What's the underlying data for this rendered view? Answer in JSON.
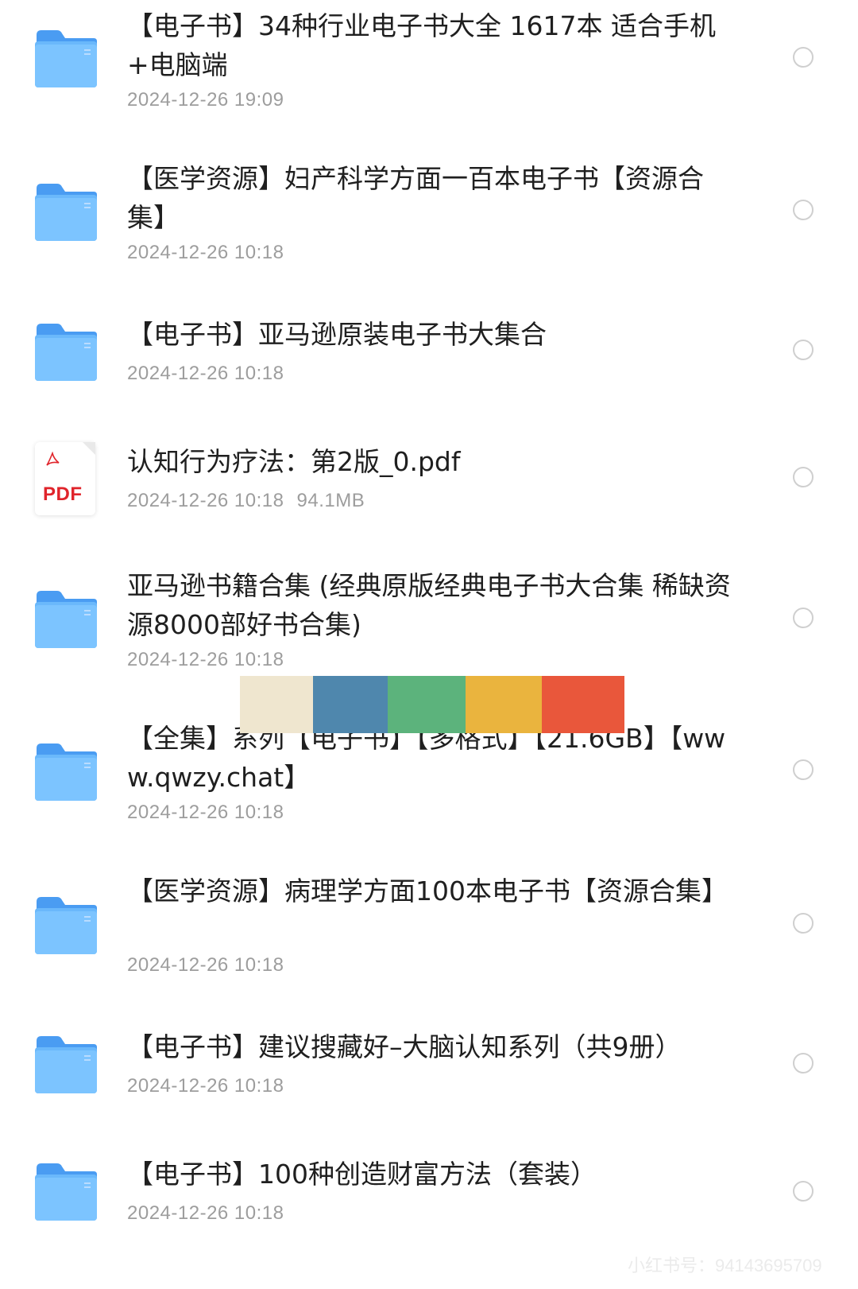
{
  "files": [
    {
      "type": "folder",
      "title": "【电子书】34种行业电子书大全 1617本 适合手机+电脑端",
      "date": "2024-12-26 19:09",
      "size": ""
    },
    {
      "type": "folder",
      "title": "【医学资源】妇产科学方面一百本电子书【资源合集】",
      "date": "2024-12-26 10:18",
      "size": ""
    },
    {
      "type": "folder",
      "title": "【电子书】亚马逊原装电子书大集合",
      "date": "2024-12-26 10:18",
      "size": ""
    },
    {
      "type": "pdf",
      "title": "认知行为疗法：第2版_0.pdf",
      "date": "2024-12-26 10:18",
      "size": "94.1MB",
      "icon_label": "PDF"
    },
    {
      "type": "folder",
      "title": "亚马逊书籍合集 (经典原版经典电子书大合集  稀缺资源8000部好书合集)",
      "date": "2024-12-26 10:18",
      "size": ""
    },
    {
      "type": "folder",
      "title": "【全集】系列【电子书】【多格式】【21.6GB】【www.qwzy.chat】",
      "date": "2024-12-26 10:18",
      "size": ""
    },
    {
      "type": "folder",
      "title": "【医学资源】病理学方面100本电子书【资源合集】",
      "date": "2024-12-26 10:18",
      "size": ""
    },
    {
      "type": "folder",
      "title": "【电子书】建议搜藏好–大脑认知系列（共9册）",
      "date": "2024-12-26 10:18",
      "size": ""
    },
    {
      "type": "folder",
      "title": "【电子书】100种创造财富方法（套装）",
      "date": "2024-12-26 10:18",
      "size": ""
    }
  ],
  "colors": {
    "folder_light": "#7cc4ff",
    "folder_dark": "#4a9cf2",
    "pdf_red": "#e0242b",
    "meta_gray": "#9d9d9d",
    "stripe": [
      "#efe6cf",
      "#4f87ad",
      "#5cb37c",
      "#eab43e",
      "#e9573b"
    ]
  },
  "watermark": "小红书号：94143695709"
}
